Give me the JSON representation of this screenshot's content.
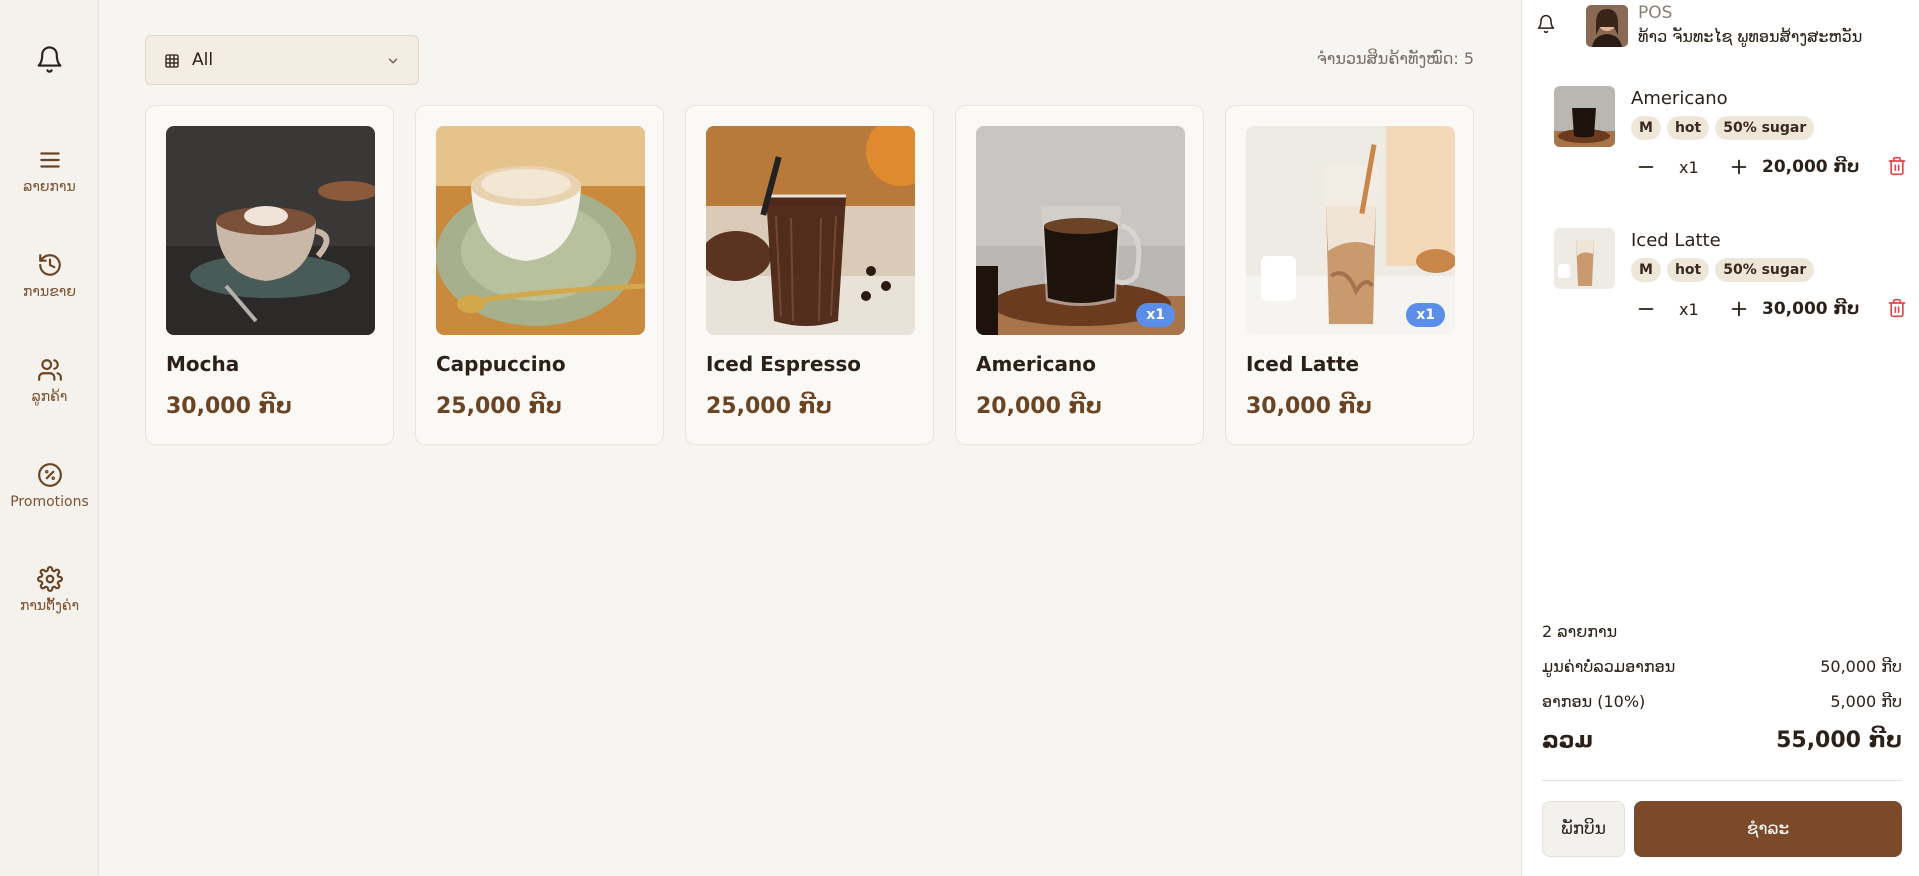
{
  "sidebar": {
    "items": [
      {
        "label": "ລາຍການ",
        "icon": "menu-icon"
      },
      {
        "label": "ການຂາຍ",
        "icon": "history-icon"
      },
      {
        "label": "ລູກຄ້າ",
        "icon": "users-icon"
      },
      {
        "label": "Promotions",
        "icon": "discount-badge-icon"
      },
      {
        "label": "ການຕັ້ງຄ່າ",
        "icon": "gear-icon"
      }
    ]
  },
  "filter": {
    "selected": "All"
  },
  "product_count_label": "ຈຳນວນສິນຄ້າທັງໝົດ: 5",
  "products": [
    {
      "name": "Mocha",
      "price": "30,000 ກີບ",
      "in_cart": ""
    },
    {
      "name": "Cappuccino",
      "price": "25,000 ກີບ",
      "in_cart": ""
    },
    {
      "name": "Iced Espresso",
      "price": "25,000 ກີບ",
      "in_cart": ""
    },
    {
      "name": "Americano",
      "price": "20,000 ກີບ",
      "in_cart": "x1"
    },
    {
      "name": "Iced Latte",
      "price": "30,000 ກີບ",
      "in_cart": "x1"
    }
  ],
  "panel": {
    "role": "POS",
    "user_name": "ທ້າວ ຈັນທະໄຊ ພູທອນສ້າງສະຫວັນ"
  },
  "order_items": [
    {
      "name": "Americano",
      "tags": [
        "M",
        "hot",
        "50% sugar"
      ],
      "qty": "x1",
      "price": "20,000 ກີບ"
    },
    {
      "name": "Iced Latte",
      "tags": [
        "M",
        "hot",
        "50% sugar"
      ],
      "qty": "x1",
      "price": "30,000 ກີບ"
    }
  ],
  "summary": {
    "items_count": "2 ລາຍການ",
    "subtotal_label": "ມູນຄ່າບໍ່ລວມອາກອນ",
    "subtotal": "50,000 ກີບ",
    "tax_label": "ອາກອນ (10%)",
    "tax": "5,000 ກີບ",
    "total_label": "ລວມ",
    "total": "55,000 ກີບ"
  },
  "actions": {
    "hold": "ພັກບິນ",
    "pay": "ຊຳລະ"
  },
  "colors": {
    "accent": "#7b4a28",
    "price": "#6b4423",
    "badge": "#5b8ee8",
    "delete": "#e04848"
  }
}
